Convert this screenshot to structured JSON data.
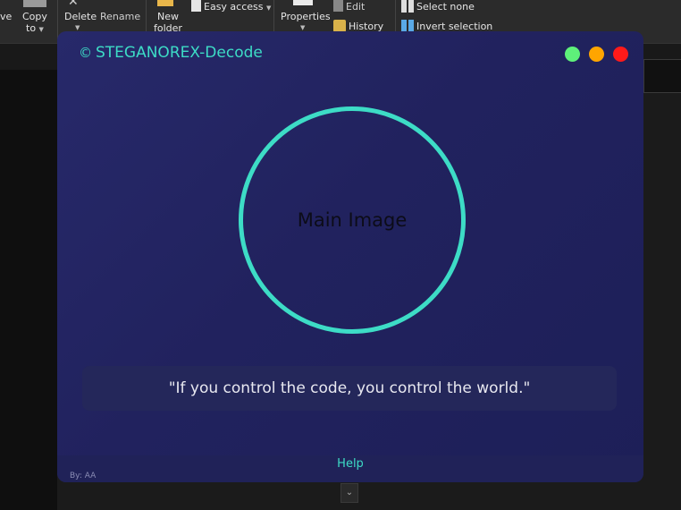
{
  "explorer": {
    "ribbon": {
      "move_label": "ve",
      "copy_label": "Copy",
      "copy_sub": "to",
      "delete_label": "Delete",
      "rename_label": "Rename",
      "new_label": "New",
      "folder_label": "folder",
      "easy_access_label": "Easy access",
      "properties_label": "Properties",
      "edit_label": "Edit",
      "history_label": "History",
      "select_none_label": "Select none",
      "invert_selection_label": "Invert selection"
    }
  },
  "app": {
    "title": "STEGANOREX-Decode",
    "title_icon": "circle-arrow-icon",
    "window_controls": {
      "green": "#5ef07a",
      "orange": "#ffa500",
      "red": "#ff1a1a"
    },
    "image_placeholder": "Main Image",
    "quote": "\"If you control the code, you control the world.\"",
    "help_label": "Help",
    "byline": "By: AA",
    "colors": {
      "accent": "#3ddcc6",
      "background": "#23255f",
      "quote_box": "#24275a"
    }
  }
}
